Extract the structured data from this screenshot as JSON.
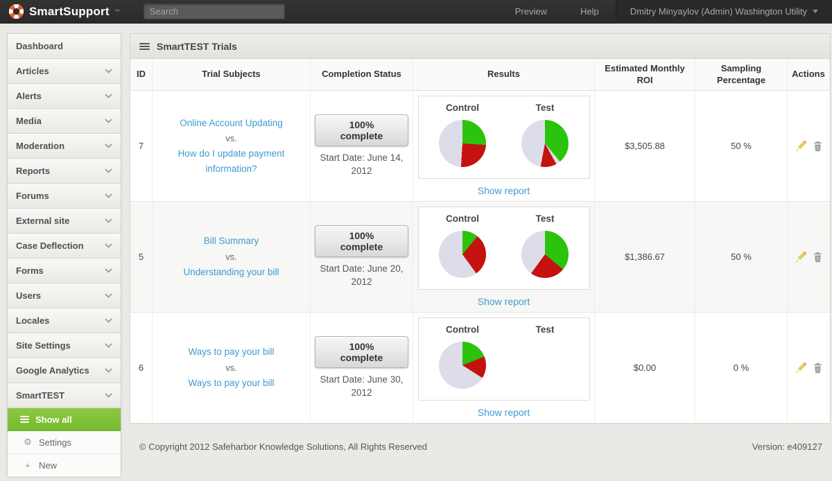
{
  "topbar": {
    "brand": "SmartSupport",
    "brand_tm": "™",
    "search_placeholder": "Search",
    "preview_label": "Preview",
    "help_label": "Help",
    "user": "Dmitry Minyaylov (Admin) Washington Utility"
  },
  "sidebar": {
    "items": [
      {
        "label": "Dashboard"
      },
      {
        "label": "Articles"
      },
      {
        "label": "Alerts"
      },
      {
        "label": "Media"
      },
      {
        "label": "Moderation"
      },
      {
        "label": "Reports"
      },
      {
        "label": "Forums"
      },
      {
        "label": "External site"
      },
      {
        "label": "Case Deflection"
      },
      {
        "label": "Forms"
      },
      {
        "label": "Users"
      },
      {
        "label": "Locales"
      },
      {
        "label": "Site Settings"
      },
      {
        "label": "Google Analytics"
      },
      {
        "label": "SmartTEST"
      }
    ],
    "submenu": [
      {
        "label": "Show all",
        "icon": "list-icon"
      },
      {
        "label": "Settings",
        "icon": "gear-icon",
        "glyph": "⚙"
      },
      {
        "label": "New",
        "icon": "plus-icon",
        "glyph": "+"
      }
    ]
  },
  "main": {
    "title": "SmartTEST Trials",
    "columns": [
      "ID",
      "Trial Subjects",
      "Completion Status",
      "Results",
      "Estimated Monthly ROI",
      "Sampling Percentage",
      "Actions"
    ],
    "rows": [
      {
        "id": "7",
        "subject_a": "Online Account Updating",
        "vs": "vs.",
        "subject_b": "How do I update payment information?",
        "status_button": "100% complete",
        "start_date": "Start Date: June 14, 2012",
        "control_label": "Control",
        "test_label": "Test",
        "show_report": "Show report",
        "roi": "$3,505.88",
        "sampling": "50 %",
        "pies": {
          "control": [
            {
              "color": "green",
              "pct": 26
            },
            {
              "color": "red",
              "pct": 25
            },
            {
              "color": "gray",
              "pct": 49
            }
          ],
          "test": [
            {
              "color": "green",
              "pct": 39
            },
            {
              "color": "gray",
              "pct": 3
            },
            {
              "color": "red",
              "pct": 11
            },
            {
              "color": "gray",
              "pct": 47
            }
          ]
        }
      },
      {
        "id": "5",
        "subject_a": "Bill Summary",
        "vs": "vs.",
        "subject_b": "Understanding your bill",
        "status_button": "100% complete",
        "start_date": "Start Date: June 20, 2012",
        "control_label": "Control",
        "test_label": "Test",
        "show_report": "Show report",
        "roi": "$1,386.67",
        "sampling": "50 %",
        "pies": {
          "control": [
            {
              "color": "green",
              "pct": 11
            },
            {
              "color": "red",
              "pct": 29
            },
            {
              "color": "gray",
              "pct": 60
            }
          ],
          "test": [
            {
              "color": "green",
              "pct": 36
            },
            {
              "color": "red",
              "pct": 24
            },
            {
              "color": "gray",
              "pct": 40
            }
          ]
        }
      },
      {
        "id": "6",
        "subject_a": "Ways to pay your bill",
        "vs": "vs.",
        "subject_b": "Ways to pay your bill",
        "status_button": "100% complete",
        "start_date": "Start Date: June 30, 2012",
        "control_label": "Control",
        "test_label": "Test",
        "show_report": "Show report",
        "roi": "$0.00",
        "sampling": "0 %",
        "pies": {
          "control": [
            {
              "color": "green",
              "pct": 19
            },
            {
              "color": "red",
              "pct": 15
            },
            {
              "color": "gray",
              "pct": 66
            }
          ],
          "test": null
        }
      }
    ]
  },
  "footer": {
    "copyright": "© Copyright 2012 Safeharbor Knowledge Solutions, All Rights Reserved",
    "version": "Version: e409127"
  },
  "colors": {
    "pie_green": "#2bc30c",
    "pie_red": "#c4120e",
    "pie_gray": "#dcdde9",
    "accent_green": "#82c338",
    "link_blue": "#3d9ad1",
    "topbar_bg": "#2e2e2e",
    "brand_orange": "#e8641f"
  }
}
